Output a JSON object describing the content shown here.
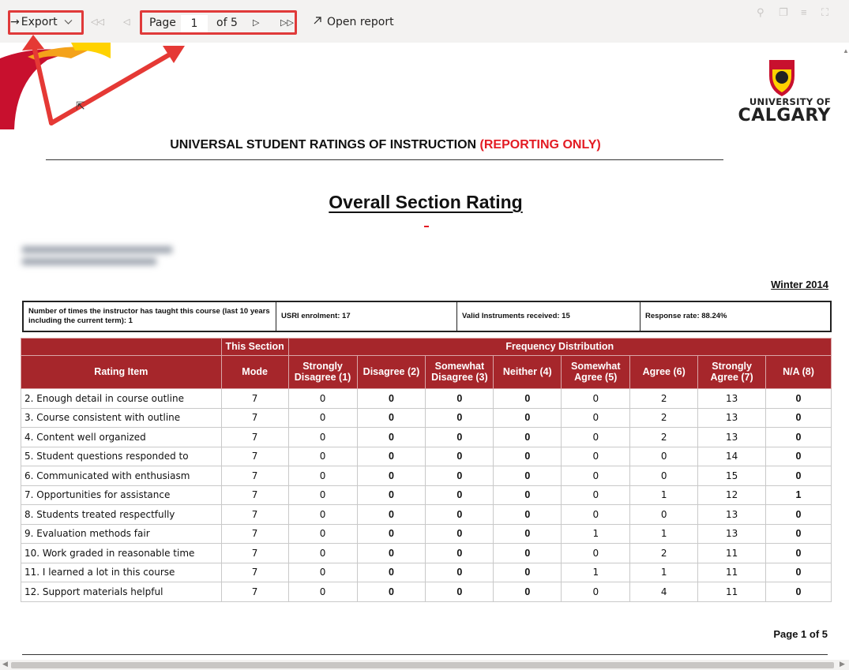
{
  "toolbar": {
    "export_label": "Export",
    "export_arrow": "→",
    "page_label": "Page",
    "page_value": "1",
    "of_label": "of 5",
    "open_report_label": "Open report",
    "highlight_color": "#e03a3a"
  },
  "report": {
    "title_main": "UNIVERSAL STUDENT RATINGS OF INSTRUCTION ",
    "title_red": "(REPORTING ONLY)",
    "logo_line1": "UNIVERSITY OF",
    "logo_line2": "CALGARY",
    "section_title": "Overall Section Rating",
    "term": "Winter 2014",
    "page_footer": "Page 1 of 5",
    "accent_color": "#a6262b"
  },
  "info": {
    "times_taught": "Number of times the instructor has taught this course (last 10 years including the current term): 1",
    "enrolment": "USRI enrolment: 17",
    "valid": "Valid Instruments received: 15",
    "response": "Response rate: 88.24%"
  },
  "table": {
    "group_this_section": "This Section",
    "group_frequency": "Frequency Distribution",
    "col_item": "Rating Item",
    "col_mode": "Mode",
    "freq_cols": [
      "Strongly Disagree (1)",
      "Disagree (2)",
      "Somewhat Disagree (3)",
      "Neither (4)",
      "Somewhat Agree (5)",
      "Agree (6)",
      "Strongly Agree (7)",
      "N/A (8)"
    ],
    "rows": [
      {
        "item": "2.  Enough detail in course outline",
        "mode": "7",
        "values": [
          "0",
          "0",
          "0",
          "0",
          "0",
          "2",
          "13",
          "0"
        ]
      },
      {
        "item": "3.  Course consistent with outline",
        "mode": "7",
        "values": [
          "0",
          "0",
          "0",
          "0",
          "0",
          "2",
          "13",
          "0"
        ]
      },
      {
        "item": "4.  Content well organized",
        "mode": "7",
        "values": [
          "0",
          "0",
          "0",
          "0",
          "0",
          "2",
          "13",
          "0"
        ]
      },
      {
        "item": "5.  Student questions responded to",
        "mode": "7",
        "values": [
          "0",
          "0",
          "0",
          "0",
          "0",
          "0",
          "14",
          "0"
        ]
      },
      {
        "item": "6.  Communicated with enthusiasm",
        "mode": "7",
        "values": [
          "0",
          "0",
          "0",
          "0",
          "0",
          "0",
          "15",
          "0"
        ]
      },
      {
        "item": "7.  Opportunities for assistance",
        "mode": "7",
        "values": [
          "0",
          "0",
          "0",
          "0",
          "0",
          "1",
          "12",
          "1"
        ]
      },
      {
        "item": "8.  Students treated respectfully",
        "mode": "7",
        "values": [
          "0",
          "0",
          "0",
          "0",
          "0",
          "0",
          "13",
          "0"
        ]
      },
      {
        "item": "9.  Evaluation methods fair",
        "mode": "7",
        "values": [
          "0",
          "0",
          "0",
          "0",
          "1",
          "1",
          "13",
          "0"
        ]
      },
      {
        "item": "10. Work graded in reasonable time",
        "mode": "7",
        "values": [
          "0",
          "0",
          "0",
          "0",
          "0",
          "2",
          "11",
          "0"
        ]
      },
      {
        "item": "11. I learned a lot in this course",
        "mode": "7",
        "values": [
          "0",
          "0",
          "0",
          "0",
          "1",
          "1",
          "11",
          "0"
        ]
      },
      {
        "item": "12. Support materials helpful",
        "mode": "7",
        "values": [
          "0",
          "0",
          "0",
          "0",
          "0",
          "4",
          "11",
          "0"
        ]
      }
    ]
  }
}
